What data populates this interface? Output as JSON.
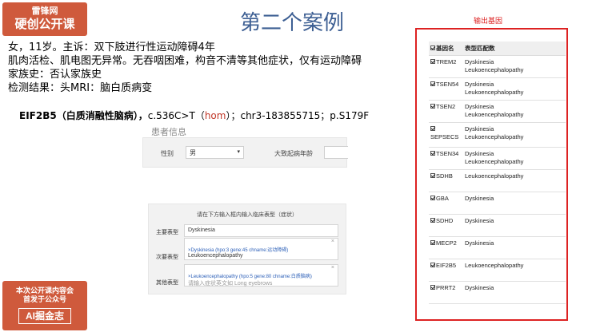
{
  "logo": {
    "line1": "雷锋网",
    "line2": "硬创公开课"
  },
  "title": "第二个案例",
  "case": {
    "line1": "女，11岁。主诉：双下肢进行性运动障碍4年",
    "line2": "肌肉活检、肌电图无异常。无吞咽困难，构音不清等其他症状，仅有运动障碍",
    "line3": "家族史：否认家族史",
    "line4": "检测结果：头MRI：脑白质病变"
  },
  "gene_line": {
    "gene": "EIF2B5（白质消融性脑病）",
    "sep1": "，",
    "mutation_prefix": "c.536C>T（",
    "hom": "hom",
    "mutation_suffix": "）；chr3-183855715；p.S179F"
  },
  "patient_form": {
    "section_label": "患者信息",
    "sex_label": "性别",
    "sex_value": "男",
    "age_label": "大致起病年龄"
  },
  "phenotype_form": {
    "heading": "请在下方输入框内输入临床表型（症状）",
    "primary_label": "主要表型",
    "primary_value": "Dyskinesia",
    "secondary_label": "次要表型",
    "secondary_tag": "×Dyskinesia (hpo:3 gene:45 chname:运动障碍)",
    "secondary_value": "Leukoencephalopathy",
    "other_label": "其他表型",
    "other_tag": "×Leukoencephalopathy (hpo:5 gene:80 chname:白质脑病)",
    "other_placeholder": "请输入症状英文如 Long eyebrows",
    "close_glyph": "×"
  },
  "output": {
    "title": "输出基因",
    "headers": [
      "基因名",
      "表型匹配数"
    ],
    "rows": [
      {
        "gene": "TREM2",
        "phenotypes": [
          "Dyskinesia",
          "Leukoencephalopathy"
        ]
      },
      {
        "gene": "TSEN54",
        "phenotypes": [
          "Dyskinesia",
          "Leukoencephalopathy"
        ]
      },
      {
        "gene": "TSEN2",
        "phenotypes": [
          "Dyskinesia",
          "Leukoencephalopathy"
        ]
      },
      {
        "gene": "SEPSECS",
        "phenotypes": [
          "Dyskinesia",
          "Leukoencephalopathy"
        ]
      },
      {
        "gene": "TSEN34",
        "phenotypes": [
          "Dyskinesia",
          "Leukoencephalopathy"
        ]
      },
      {
        "gene": "SDHB",
        "phenotypes": [
          "Leukoencephalopathy"
        ]
      },
      {
        "gene": "GBA",
        "phenotypes": [
          "Dyskinesia"
        ]
      },
      {
        "gene": "SDHD",
        "phenotypes": [
          "Dyskinesia"
        ]
      },
      {
        "gene": "MECP2",
        "phenotypes": [
          "Dyskinesia"
        ]
      },
      {
        "gene": "EIF2B5",
        "phenotypes": [
          "Leukoencephalopathy"
        ]
      },
      {
        "gene": "PRRT2",
        "phenotypes": [
          "Dyskinesia"
        ]
      }
    ]
  },
  "bottom_badge": {
    "line1": "本次公开课内容会",
    "line2": "首发于公众号",
    "brand": "AI掘金志"
  },
  "colors": {
    "brand": "#cf5a3c",
    "title": "#3d5f93",
    "highlight": "#d22222",
    "link": "#2d60b8"
  }
}
